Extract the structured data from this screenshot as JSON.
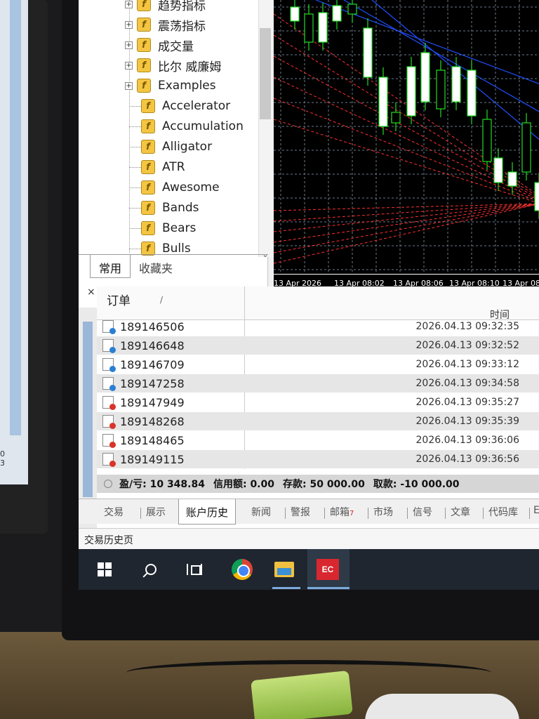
{
  "navigator": {
    "items": [
      {
        "label": "趋势指标",
        "expandable": true
      },
      {
        "label": "震荡指标",
        "expandable": true
      },
      {
        "label": "成交量",
        "expandable": true
      },
      {
        "label": "比尔 威廉姆",
        "expandable": true
      },
      {
        "label": "Examples",
        "expandable": true
      },
      {
        "label": "Accelerator",
        "expandable": false
      },
      {
        "label": "Accumulation",
        "expandable": false
      },
      {
        "label": "Alligator",
        "expandable": false
      },
      {
        "label": "ATR",
        "expandable": false
      },
      {
        "label": "Awesome",
        "expandable": false
      },
      {
        "label": "Bands",
        "expandable": false
      },
      {
        "label": "Bears",
        "expandable": false
      },
      {
        "label": "Bulls",
        "expandable": false
      }
    ],
    "tabs": [
      "常用",
      "收藏夹"
    ],
    "icon": "indicator-f-icon",
    "icon_glyph": "f"
  },
  "chart": {
    "x_labels": [
      "13 Apr 2026",
      "13 Apr 08:02",
      "13 Apr 08:06",
      "13 Apr 08:10",
      "13 Apr 08:1"
    ],
    "colors": {
      "background": "#000000",
      "bull_body": "#ffffff",
      "outline": "#22dd22",
      "grid": "#6a7a8a",
      "red_lines": "#ff3030",
      "blue_lines": "#2050ff"
    }
  },
  "terminal": {
    "close_symbol": "×",
    "header": {
      "order": "订单",
      "sort_indicator": "/",
      "time": "时间"
    },
    "orders": [
      {
        "id": "189146506",
        "time": "2026.04.13 09:32:35",
        "type": "buy"
      },
      {
        "id": "189146648",
        "time": "2026.04.13 09:32:52",
        "type": "buy"
      },
      {
        "id": "189146709",
        "time": "2026.04.13 09:33:12",
        "type": "buy"
      },
      {
        "id": "189147258",
        "time": "2026.04.13 09:34:58",
        "type": "buy"
      },
      {
        "id": "189147949",
        "time": "2026.04.13 09:35:27",
        "type": "sell"
      },
      {
        "id": "189148268",
        "time": "2026.04.13 09:35:39",
        "type": "sell"
      },
      {
        "id": "189148465",
        "time": "2026.04.13 09:36:06",
        "type": "sell"
      },
      {
        "id": "189149115",
        "time": "2026.04.13 09:36:56",
        "type": "sell"
      }
    ],
    "summary": {
      "profit": "盈/亏: 10 348.84",
      "credit": "信用额: 0.00",
      "deposit": "存款: 50 000.00",
      "withdrawal": "取款: -10 000.00"
    },
    "tabs": [
      "交易",
      "展示",
      "账户历史",
      "新闻",
      "警报",
      "邮箱",
      "市场",
      "信号",
      "文章",
      "代码库",
      "E"
    ],
    "active_tab": "账户历史",
    "mail_count": "7",
    "status_text": "交易历史页",
    "colors": {
      "buy_dot": "#2a7fd4",
      "sell_dot": "#d9332a"
    }
  },
  "taskbar": {
    "icons": [
      "windows-start-icon",
      "search-icon",
      "task-view-icon",
      "chrome-icon",
      "file-explorer-icon",
      "trading-app-icon"
    ],
    "app_label": "EC"
  },
  "left_monitor": {
    "text": "0\n3"
  }
}
